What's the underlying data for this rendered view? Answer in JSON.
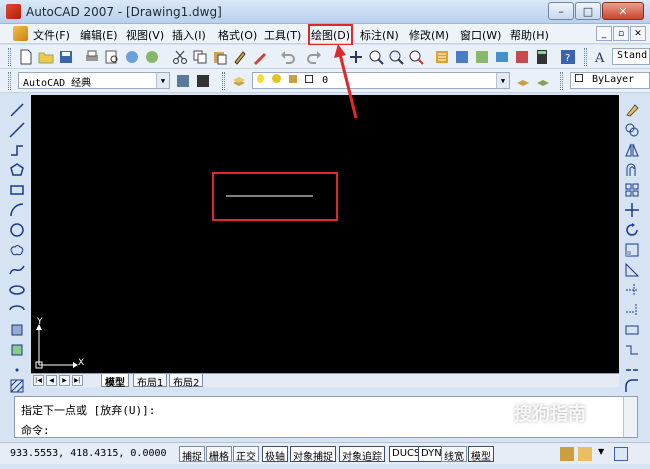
{
  "window": {
    "title": "AutoCAD 2007 - [Drawing1.dwg]",
    "controls": [
      "–",
      "□",
      "✕"
    ]
  },
  "menubar": {
    "items": [
      {
        "label": "文件(F)"
      },
      {
        "label": "编辑(E)"
      },
      {
        "label": "视图(V)"
      },
      {
        "label": "插入(I)"
      },
      {
        "label": "格式(O)"
      },
      {
        "label": "工具(T)"
      },
      {
        "label": "绘图(D)"
      },
      {
        "label": "标注(N)"
      },
      {
        "label": "修改(M)"
      },
      {
        "label": "窗口(W)"
      },
      {
        "label": "帮助(H)"
      }
    ],
    "highlighted": "绘图(D)",
    "mdi_controls": [
      "_",
      "▫",
      "✕"
    ]
  },
  "toolbar1": {
    "text_style": "Stand"
  },
  "toolbar2": {
    "workspace": "AutoCAD 经典",
    "layer": "0",
    "linetype": "ByLayer"
  },
  "canvas": {
    "background": "#000000",
    "axis_y": "Y",
    "axis_x": "X"
  },
  "layout_tabs": {
    "items": [
      {
        "label": "模型",
        "active": true
      },
      {
        "label": "布局1",
        "active": false
      },
      {
        "label": "布局2",
        "active": false
      }
    ]
  },
  "command": {
    "history": "指定下一点或 [放弃(U)]:",
    "prompt": "命令:"
  },
  "status": {
    "coords": "933.5553,  418.4315, 0.0000",
    "buttons": [
      "捕捉",
      "栅格",
      "正交",
      "极轴",
      "对象捕捉",
      "对象追踪",
      "DUCS",
      "DYN",
      "线宽",
      "模型"
    ]
  },
  "watermark": {
    "text": "搜狗指南",
    "url": "zhinan.sogou.com"
  },
  "colors": {
    "highlight_red": "#e0282a",
    "canvas_line": "#ffffff"
  }
}
